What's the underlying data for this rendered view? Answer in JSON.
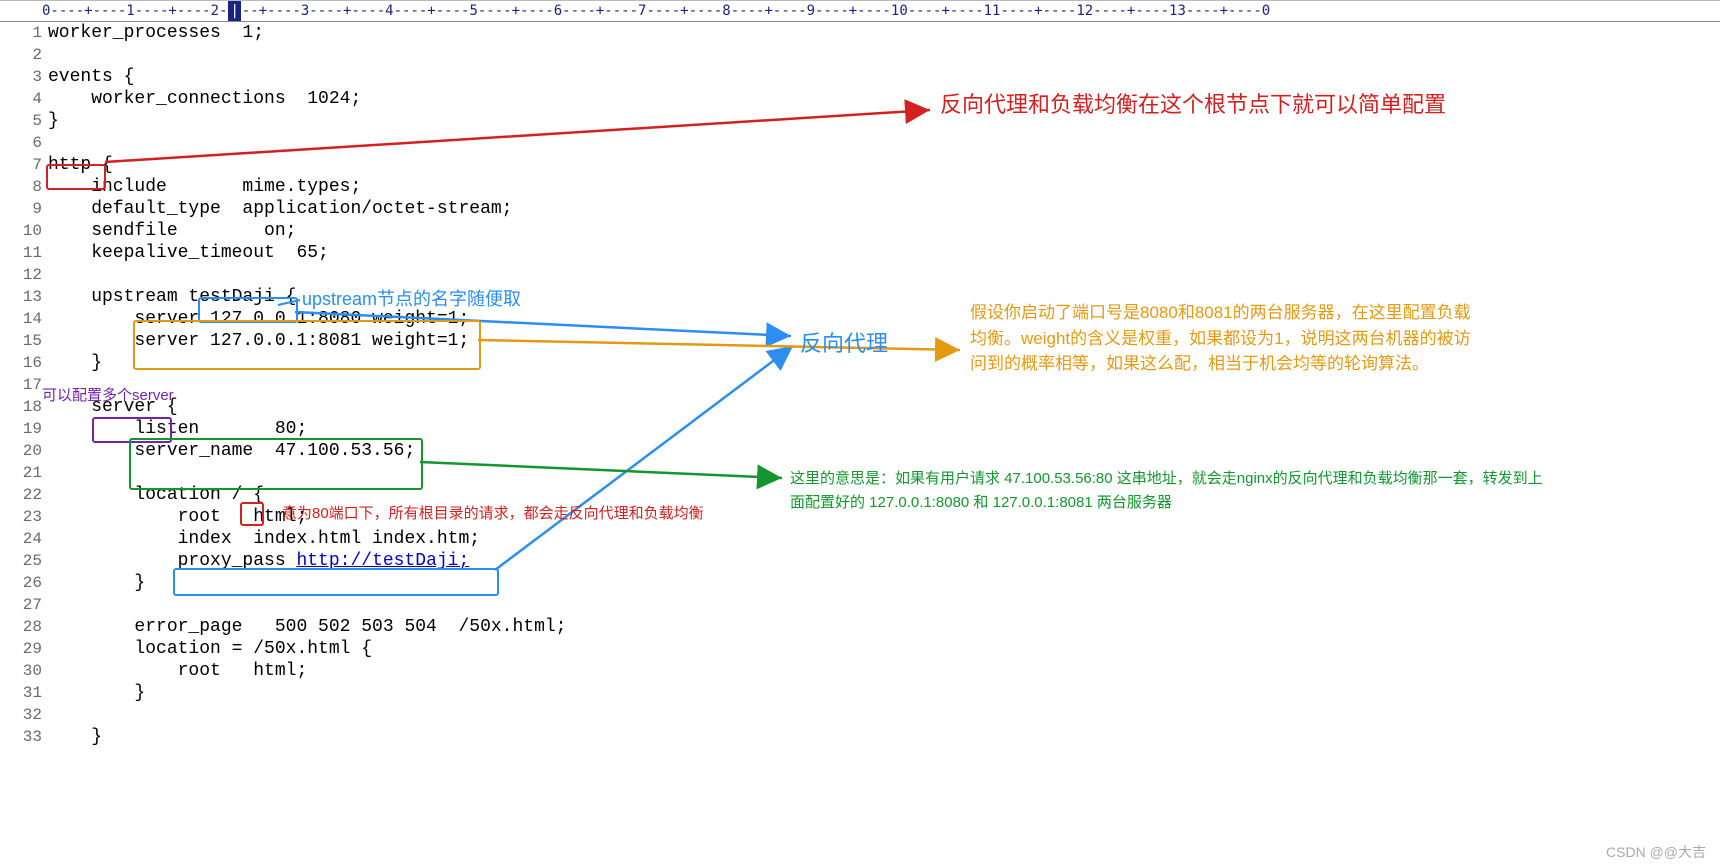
{
  "ruler_cursor_mark": "|",
  "lines": [
    {
      "n": "1",
      "t": "worker_processes  1;"
    },
    {
      "n": "2",
      "t": ""
    },
    {
      "n": "3",
      "t": "events {"
    },
    {
      "n": "4",
      "t": "    worker_connections  1024;"
    },
    {
      "n": "5",
      "t": "}"
    },
    {
      "n": "6",
      "t": ""
    },
    {
      "n": "7",
      "t": "http {"
    },
    {
      "n": "8",
      "t": "    include       mime.types;"
    },
    {
      "n": "9",
      "t": "    default_type  application/octet-stream;"
    },
    {
      "n": "10",
      "t": "    sendfile        on;"
    },
    {
      "n": "11",
      "t": "    keepalive_timeout  65;"
    },
    {
      "n": "12",
      "t": ""
    },
    {
      "n": "13",
      "t": "    upstream testDaji {"
    },
    {
      "n": "14",
      "t": "        server 127.0.0.1:8080 weight=1;"
    },
    {
      "n": "15",
      "t": "        server 127.0.0.1:8081 weight=1;"
    },
    {
      "n": "16",
      "t": "    }"
    },
    {
      "n": "17",
      "t": ""
    },
    {
      "n": "18",
      "t": "    server {"
    },
    {
      "n": "19",
      "t": "        listen       80;"
    },
    {
      "n": "20",
      "t": "        server_name  47.100.53.56;"
    },
    {
      "n": "21",
      "t": ""
    },
    {
      "n": "22",
      "t": "        location / {"
    },
    {
      "n": "23",
      "t": "            root   html;"
    },
    {
      "n": "24",
      "t": "            index  index.html index.htm;"
    },
    {
      "n": "25",
      "t": "            proxy_pass http://testDaji;",
      "link_start": 23
    },
    {
      "n": "26",
      "t": "        }"
    },
    {
      "n": "27",
      "t": ""
    },
    {
      "n": "28",
      "t": "        error_page   500 502 503 504  /50x.html;"
    },
    {
      "n": "29",
      "t": "        location = /50x.html {"
    },
    {
      "n": "30",
      "t": "            root   html;"
    },
    {
      "n": "31",
      "t": "        }"
    },
    {
      "n": "32",
      "t": ""
    },
    {
      "n": "33",
      "t": "    }"
    }
  ],
  "annotations": {
    "note_red_http": "反向代理和负载均衡在这个根节点下就可以简单配置",
    "note_blue_upstream_name": "upstream节点的名字随便取",
    "note_blue_upstream_big": "反向代理",
    "note_orange_upstream": "假设你启动了端口号是8080和8081的两台服务器，在这里配置负载均衡。weight的含义是权重，如果都设为1，说明这两台机器的被访问到的概率相等，如果这么配，相当于机会均等的轮询算法。",
    "note_purple_server": "可以配置多个server",
    "note_green_server": "这里的意思是：如果有用户请求 47.100.53.56:80 这串地址，就会走nginx的反向代理和负载均衡那一套，转发到上面配置好的 127.0.0.1:8080 和 127.0.0.1:8081 两台服务器",
    "note_red_location": "意为80端口下，所有根目录的请求，都会走反向代理和负载均衡"
  },
  "watermark": "CSDN @@大吉"
}
